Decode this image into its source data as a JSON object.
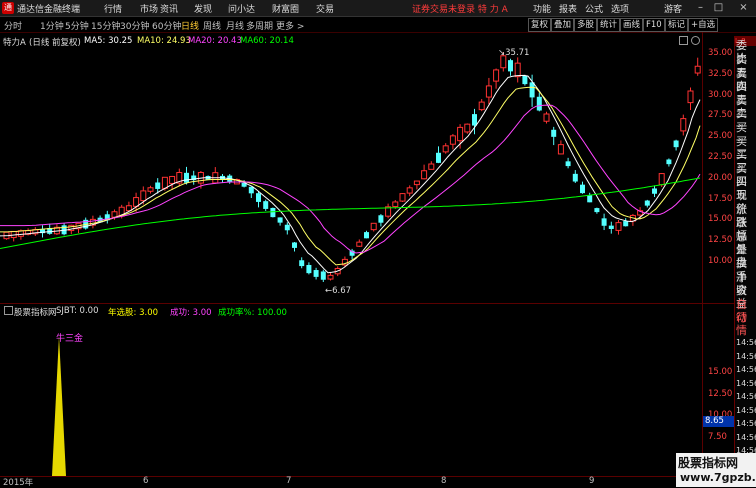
{
  "menubar": {
    "app_title": "通达信金融终端",
    "items": [
      "行情",
      "市场",
      "资讯",
      "发现",
      "问小达",
      "财富圈",
      "交易"
    ],
    "notice": "证券交易未登录  特 力 A",
    "right_items": [
      "功能",
      "报表",
      "公式",
      "选项",
      "游客"
    ]
  },
  "periodbar": {
    "periods": [
      "分时",
      "1分钟",
      "5分钟",
      "15分钟",
      "30分钟",
      "60分钟",
      "日线",
      "周线",
      "月线",
      "多周期",
      "更多 >"
    ],
    "active": "日线",
    "tools": [
      "复权",
      "叠加",
      "多股",
      "统计",
      "画线",
      "F10",
      "标记",
      "+自选"
    ]
  },
  "info": {
    "stock": "特力A",
    "mode": "(日线 前复权)",
    "ma5_label": "MA5: 30.25",
    "ma10_label": "MA10: 24.93",
    "ma20_label": "MA20: 20.43",
    "ma60_label": "MA60: 20.14",
    "colors": {
      "ma5": "#ffffff",
      "ma10": "#ffff66",
      "ma20": "#ff44ff",
      "ma60": "#00ff00"
    }
  },
  "price_axis": [
    "35.00",
    "32.50",
    "30.00",
    "27.50",
    "25.00",
    "22.50",
    "20.00",
    "17.50",
    "15.00",
    "12.50",
    "10.00"
  ],
  "annotations": {
    "high": "35.71",
    "low": "6.67"
  },
  "indicator": {
    "name": "股票指标网",
    "sjbt": "SJBT: 0.00",
    "years_label": "年选股:",
    "years_value": "3.00",
    "success_label": "成功:",
    "success_value": "3.00",
    "rate_label": "成功率%:",
    "rate_value": "100.00",
    "signal_label": "牛三金",
    "current_value": "8.65",
    "axis": [
      "15.00",
      "12.50",
      "10.00",
      "7.50",
      "5.00"
    ]
  },
  "dates": [
    "2015年",
    "6",
    "7",
    "8",
    "9"
  ],
  "right_panel": {
    "top": "委比",
    "items": [
      "卖五",
      "卖四",
      "卖三",
      "卖二",
      "卖一",
      "买一",
      "买二",
      "买三",
      "买四",
      "买五",
      "现价",
      "涨跌",
      "涨幅",
      "总量",
      "外盘",
      "换手",
      "净资",
      "收益",
      "自动",
      "行情",
      "14:56",
      "14:56",
      "14:56",
      "14:56",
      "14:56",
      "14:56",
      "14:56",
      "14:56",
      "14:56"
    ]
  },
  "watermark": {
    "line1": "股票指标网",
    "line2": "www.7gpzb.com"
  }
}
